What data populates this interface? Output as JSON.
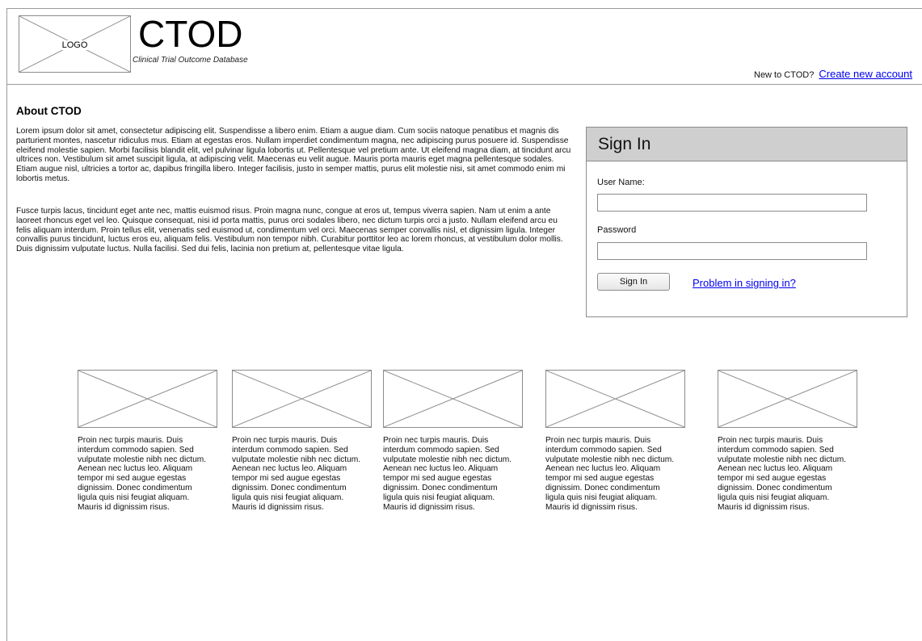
{
  "header": {
    "logo_label": "LOGO",
    "title": "CTOD",
    "subtitle": "Clinical Trial Outcome Database",
    "new_prompt": "New to CTOD?",
    "create_account_link": "Create new account"
  },
  "about": {
    "title": "About CTOD",
    "paragraphs": [
      "Lorem ipsum dolor sit amet, consectetur adipiscing elit. Suspendisse a libero enim. Etiam a augue diam. Cum sociis natoque penatibus et magnis dis parturient montes, nascetur ridiculus mus. Etiam at egestas eros. Nullam imperdiet condimentum magna, nec adipiscing purus posuere id. Suspendisse eleifend molestie sapien. Morbi facilisis blandit elit, vel pulvinar ligula lobortis ut. Pellentesque vel pretium ante. Ut eleifend magna diam, at tincidunt arcu ultrices non. Vestibulum sit amet suscipit ligula, at adipiscing velit. Maecenas eu velit augue. Mauris porta mauris eget magna pellentesque sodales. Etiam augue nisl, ultricies a tortor ac, dapibus fringilla libero. Integer facilisis, justo in semper mattis, purus elit molestie nisi, sit amet commodo enim mi lobortis metus.",
      "Fusce turpis lacus, tincidunt eget ante nec, mattis euismod risus. Proin magna nunc, congue at eros ut, tempus viverra sapien. Nam ut enim a ante laoreet rhoncus eget vel leo. Quisque consequat, nisi id porta mattis, purus orci sodales libero, nec dictum turpis orci a justo. Nullam eleifend arcu eu felis aliquam interdum. Proin tellus elit, venenatis sed euismod ut, condimentum vel orci. Maecenas semper convallis nisl, et dignissim ligula. Integer convallis purus tincidunt, luctus eros eu, aliquam felis. Vestibulum non tempor nibh. Curabitur porttitor leo ac lorem rhoncus, at vestibulum dolor mollis. Duis dignissim vulputate luctus. Nulla facilisi. Sed dui felis, lacinia non pretium at, pellentesque vitae ligula."
    ]
  },
  "signin": {
    "title": "Sign In",
    "username_label": "User Name:",
    "username_value": "",
    "password_label": "Password",
    "password_value": "",
    "button_label": "Sign In",
    "problem_link": "Problem in signing in?"
  },
  "cards": [
    {
      "text": "Proin nec turpis mauris. Duis interdum commodo sapien. Sed vulputate molestie nibh nec dictum. Aenean nec luctus leo. Aliquam tempor mi sed augue egestas dignissim. Donec condimentum ligula quis nisi feugiat aliquam. Mauris id dignissim risus."
    },
    {
      "text": "Proin nec turpis mauris. Duis interdum commodo sapien. Sed vulputate molestie nibh nec dictum. Aenean nec luctus leo. Aliquam tempor mi sed augue egestas dignissim. Donec condimentum ligula quis nisi feugiat aliquam. Mauris id dignissim risus."
    },
    {
      "text": "Proin nec turpis mauris. Duis interdum commodo sapien. Sed vulputate molestie nibh nec dictum. Aenean nec luctus leo. Aliquam tempor mi sed augue egestas dignissim. Donec condimentum ligula quis nisi feugiat aliquam. Mauris id dignissim risus."
    },
    {
      "text": "Proin nec turpis mauris. Duis interdum commodo sapien. Sed vulputate molestie nibh nec dictum. Aenean nec luctus leo. Aliquam tempor mi sed augue egestas dignissim. Donec condimentum ligula quis nisi feugiat aliquam. Mauris id dignissim risus."
    },
    {
      "text": "Proin nec turpis mauris. Duis interdum commodo sapien. Sed vulputate molestie nibh nec dictum. Aenean nec luctus leo. Aliquam tempor mi sed augue egestas dignissim. Donec condimentum ligula quis nisi feugiat aliquam. Mauris id dignissim risus."
    }
  ],
  "colors": {
    "link": "#0000ee",
    "panel_header": "#cfcfcf",
    "border": "#8c8c8c"
  }
}
